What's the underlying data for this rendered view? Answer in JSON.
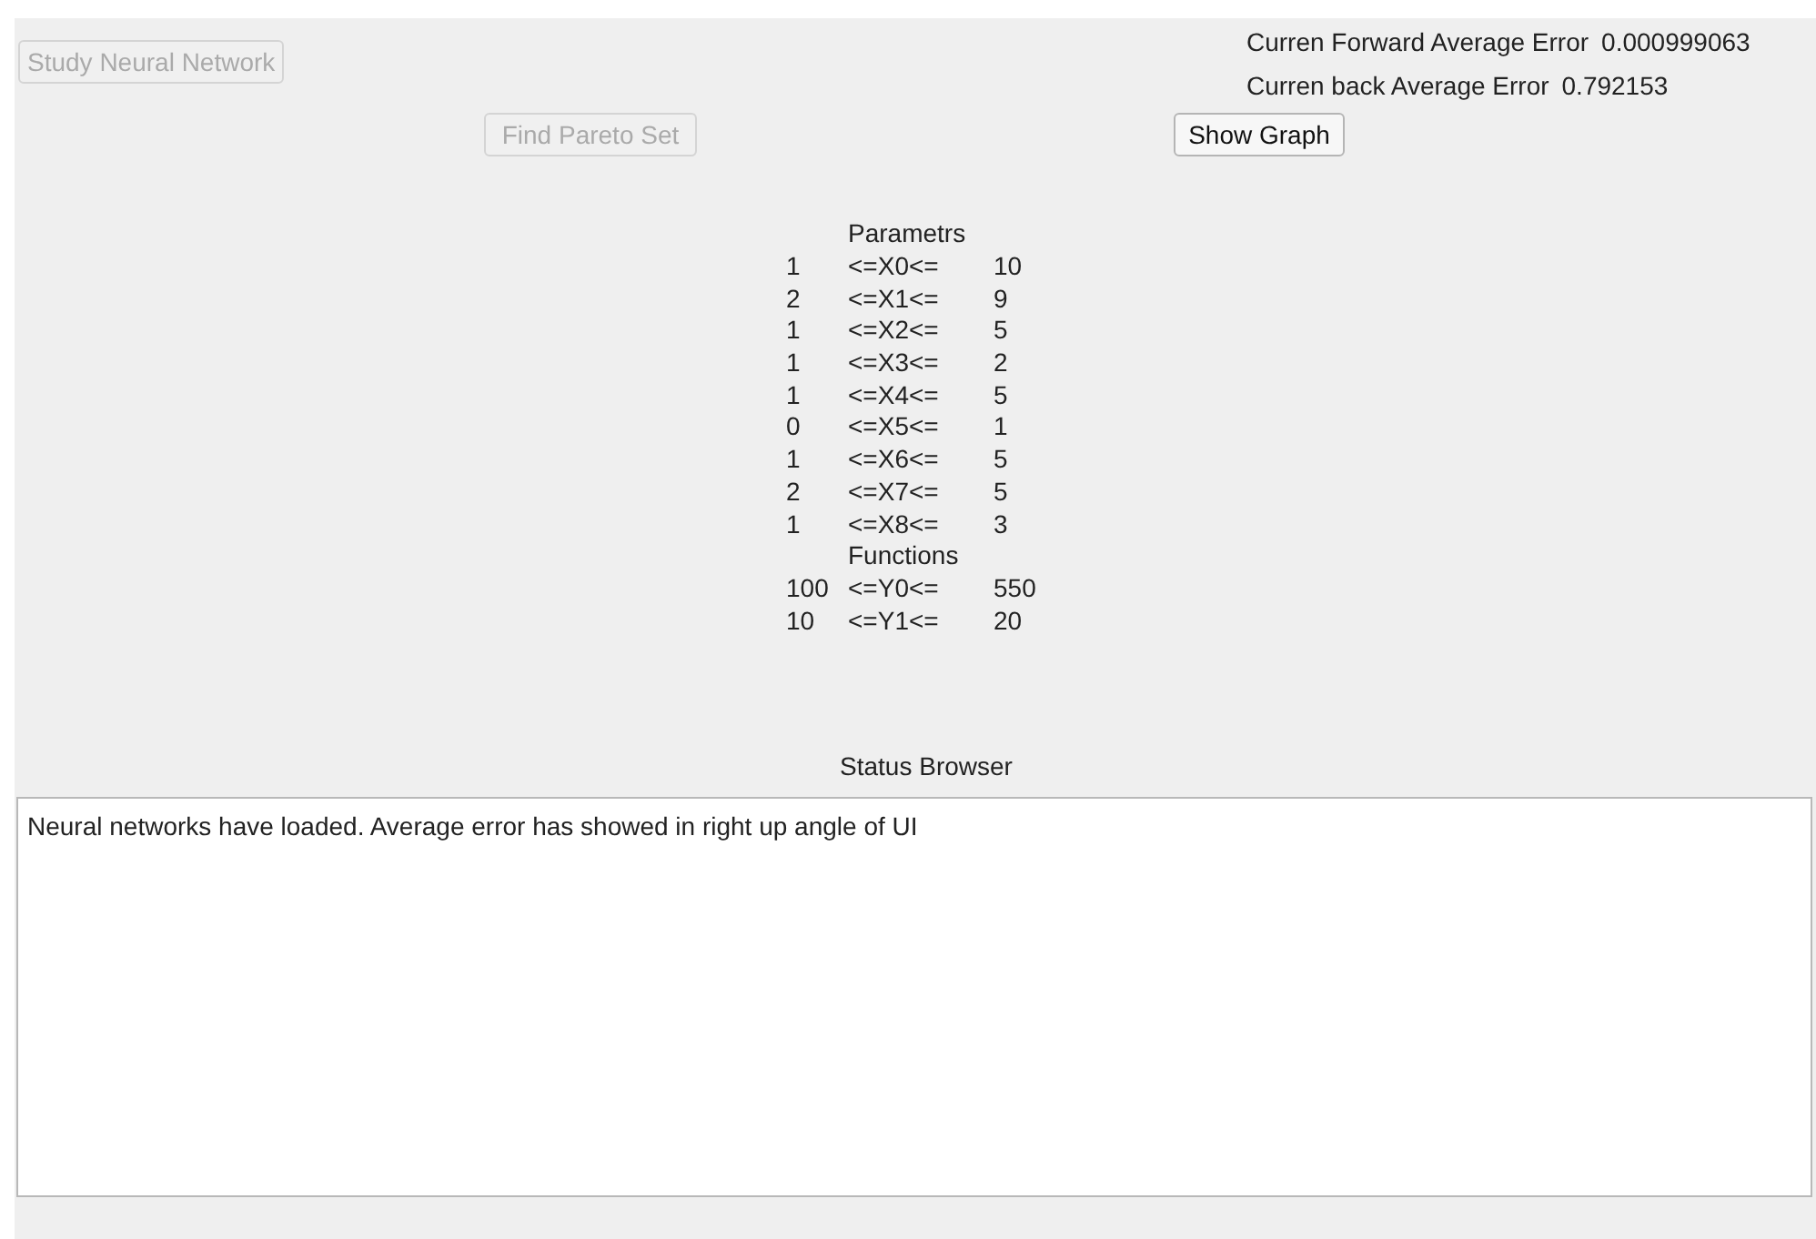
{
  "buttons": [
    {
      "label": "Study Neural Network",
      "disabled": true
    },
    {
      "label": "Find Pareto Set",
      "disabled": true
    },
    {
      "label": "Show Graph",
      "disabled": false
    }
  ],
  "errors": [
    {
      "label": "Curren Forward Average Error",
      "value": "0.000999063"
    },
    {
      "label": "Curren back Average Error",
      "value": "0.792153"
    }
  ],
  "bounds": [
    {
      "title": "Parametrs",
      "rows": [
        {
          "min": "1",
          "variable": "<=X0<=",
          "max": "10"
        },
        {
          "min": "2",
          "variable": "<=X1<=",
          "max": "9"
        },
        {
          "min": "1",
          "variable": "<=X2<=",
          "max": "5"
        },
        {
          "min": "1",
          "variable": "<=X3<=",
          "max": "2"
        },
        {
          "min": "1",
          "variable": "<=X4<=",
          "max": "5"
        },
        {
          "min": "0",
          "variable": "<=X5<=",
          "max": "1"
        },
        {
          "min": "1",
          "variable": "<=X6<=",
          "max": "5"
        },
        {
          "min": "2",
          "variable": "<=X7<=",
          "max": "5"
        },
        {
          "min": "1",
          "variable": "<=X8<=",
          "max": "3"
        }
      ]
    },
    {
      "title": "Functions",
      "rows": [
        {
          "min": "100",
          "variable": "<=Y0<=",
          "max": "550"
        },
        {
          "min": "10",
          "variable": "<=Y1<=",
          "max": "20"
        }
      ]
    }
  ],
  "status_browser": {
    "title": "Status Browser",
    "text": "Neural networks have loaded. Average error has showed in right up angle of UI"
  }
}
